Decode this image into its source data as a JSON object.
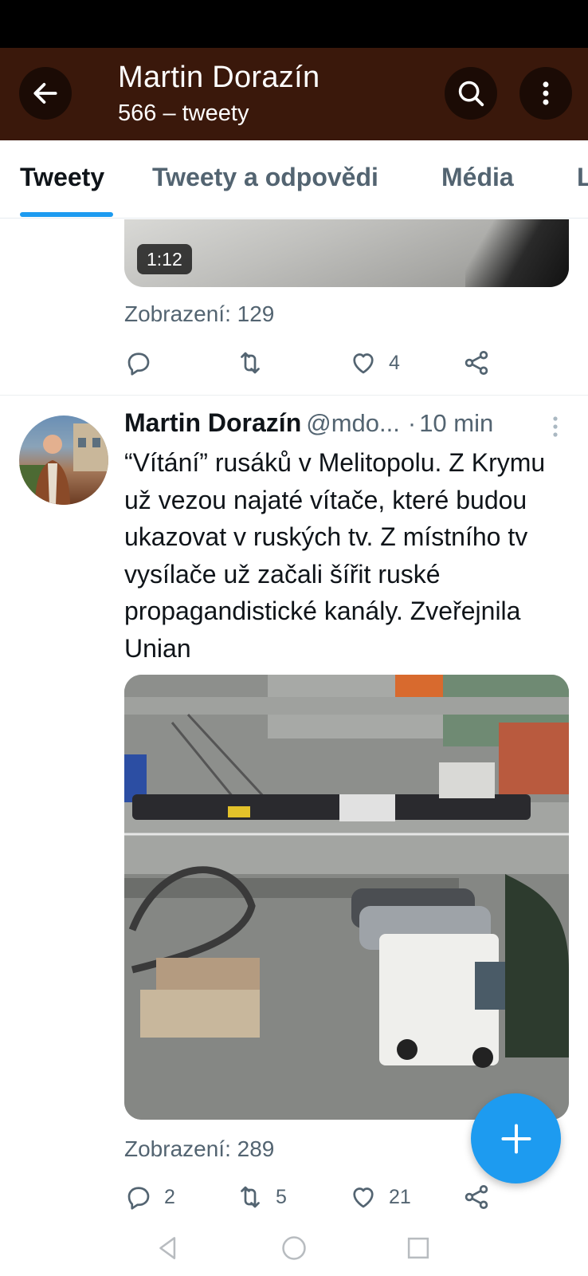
{
  "header": {
    "title": "Martin Dorazín",
    "subtitle": "566 – tweety",
    "back_icon": "back-arrow-icon",
    "search_icon": "search-icon",
    "more_icon": "more-vertical-icon",
    "background": "#3a180b"
  },
  "tabs": [
    {
      "label": "Tweety",
      "active": true
    },
    {
      "label": "Tweety a odpovědi",
      "active": false
    },
    {
      "label": "Média",
      "active": false
    },
    {
      "label": "L",
      "active": false
    }
  ],
  "previous_tweet": {
    "video_duration": "1:12",
    "views": "Zobrazení: 129",
    "actions": {
      "reply": "",
      "retweet": "",
      "like": "4"
    }
  },
  "tweet": {
    "author": "Martin Dorazín",
    "handle": "@mdo...",
    "separator": "·",
    "time": "10 min",
    "text": "“Vítání” rusáků v Melitopolu. Z Krymu už vezou najaté vítače, které budou ukazovat v ruských tv. Z místního tv vysílače už začali šířit ruské  propagandistické kanály. Zveřejnila Unian",
    "views": "Zobrazení: 289",
    "actions": {
      "reply": "2",
      "retweet": "5",
      "like": "21"
    }
  },
  "fab_icon": "compose-plus-icon",
  "colors": {
    "accent": "#1d9bf0",
    "secondary_text": "#536471",
    "primary_text": "#0f1419"
  },
  "system_nav": [
    "back-triangle-icon",
    "home-circle-icon",
    "recents-square-icon"
  ]
}
